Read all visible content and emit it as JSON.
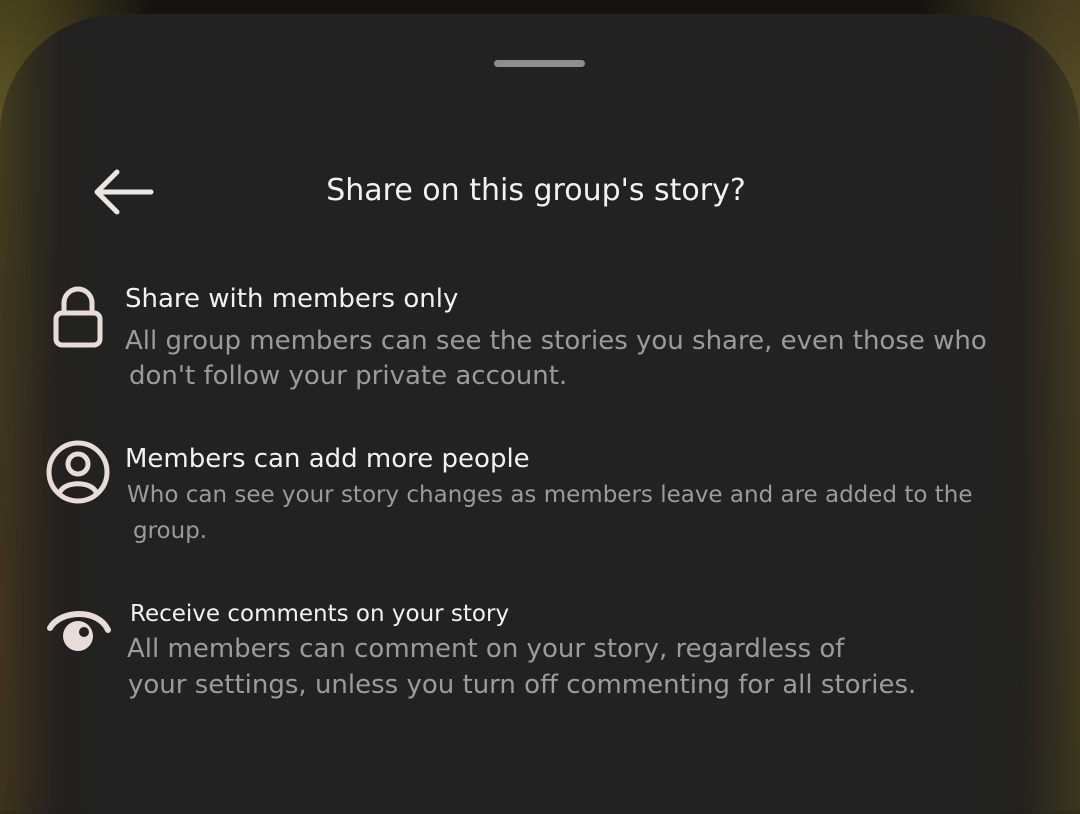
{
  "sheet": {
    "title": "Share on this group's story?",
    "back_icon": "arrow-left-icon"
  },
  "items": [
    {
      "icon": "lock-icon",
      "title": "Share with members only",
      "description_line1": "All group members can see the stories you share, even those who",
      "description_line2": "don't follow your private account."
    },
    {
      "icon": "person-circle-icon",
      "title": "Members can add more people",
      "description_line1": "Who can see your story changes as members leave and are added to the",
      "description_line2": "group."
    },
    {
      "icon": "comment-bubble-icon",
      "title": "Receive comments on your story",
      "description_line1": "All members can comment on your story, regardless of",
      "description_line2": "your settings, unless you turn off commenting for all stories."
    }
  ],
  "colors": {
    "sheet_background": "#222222",
    "primary_text": "#f2f2f2",
    "secondary_text": "#9b9b9b",
    "icon": "#e8dcd6"
  }
}
